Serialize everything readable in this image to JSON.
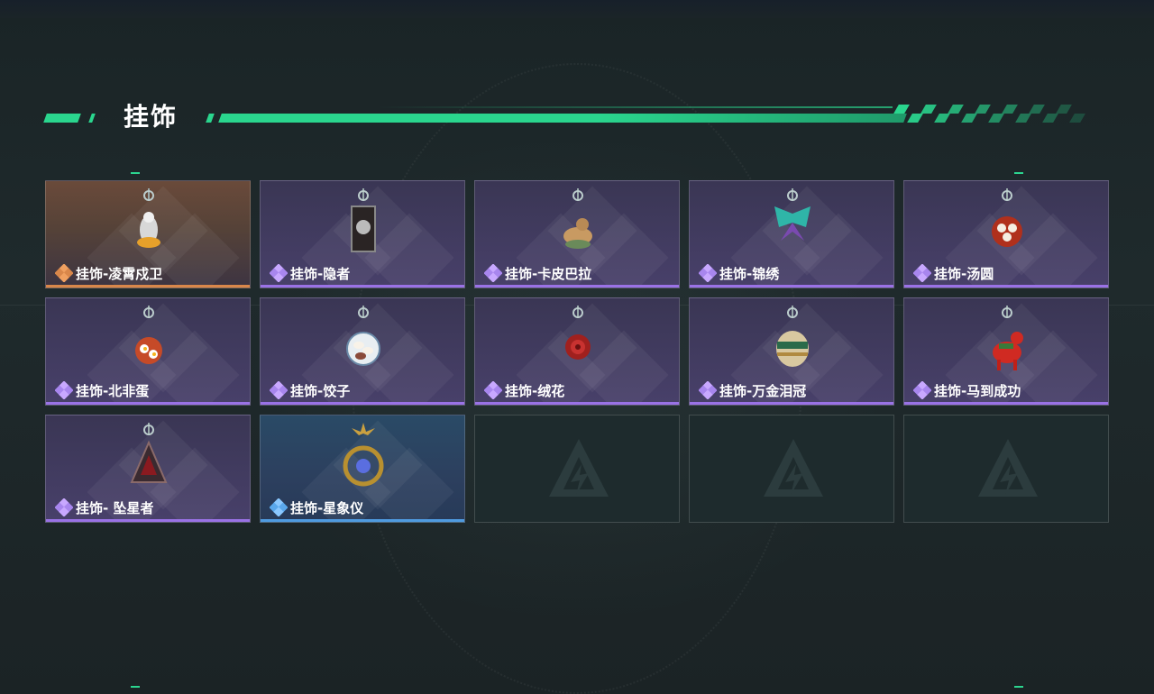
{
  "header": {
    "title": "挂饰"
  },
  "colors": {
    "accent": "#2ad68e",
    "rare_purple": "#9a72e6",
    "legend_orange": "#d9874a",
    "blue": "#4f9be0"
  },
  "items": [
    {
      "label": "挂饰-凌霄戍卫",
      "rarity": "orange",
      "icon": "guard-doll-charm-icon"
    },
    {
      "label": "挂饰-隐者",
      "rarity": "purple",
      "icon": "hermit-card-charm-icon"
    },
    {
      "label": "挂饰-卡皮巴拉",
      "rarity": "purple",
      "icon": "capybara-charm-icon"
    },
    {
      "label": "挂饰-锦绣",
      "rarity": "purple",
      "icon": "butterfly-charm-icon"
    },
    {
      "label": "挂饰-汤圆",
      "rarity": "purple",
      "icon": "tangyuan-bowl-charm-icon"
    },
    {
      "label": "挂饰-北非蛋",
      "rarity": "purple",
      "icon": "shakshuka-charm-icon"
    },
    {
      "label": "挂饰-饺子",
      "rarity": "purple",
      "icon": "dumpling-plate-charm-icon"
    },
    {
      "label": "挂饰-绒花",
      "rarity": "purple",
      "icon": "velvet-flower-charm-icon"
    },
    {
      "label": "挂饰-万金泪冠",
      "rarity": "purple",
      "icon": "golden-crown-charm-icon"
    },
    {
      "label": "挂饰-马到成功",
      "rarity": "purple",
      "icon": "red-horse-charm-icon"
    },
    {
      "label": "挂饰- 坠星者",
      "rarity": "purple",
      "icon": "triangle-sigil-charm-icon"
    },
    {
      "label": "挂饰-星象仪",
      "rarity": "blue",
      "icon": "astrolabe-charm-icon"
    }
  ],
  "empty_slots": 3
}
